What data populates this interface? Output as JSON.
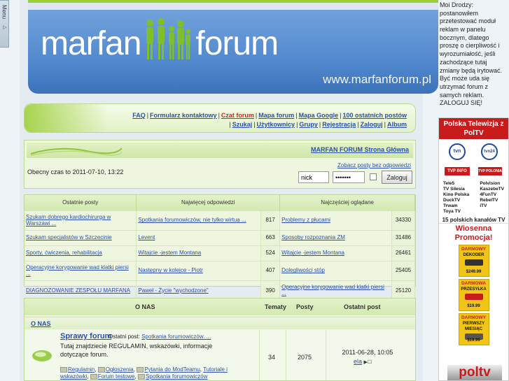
{
  "menu_tab": {
    "label": "Menu"
  },
  "header": {
    "logo_left": "marfan",
    "logo_right": "forum",
    "url": "www.marfanforum.pl"
  },
  "nav": {
    "line1": [
      "FAQ",
      "Formularz kontaktowy",
      "Czat forum",
      "Mapa forum",
      "Mapa Google",
      "100 ostatnich postów"
    ],
    "line2": [
      "Szukaj",
      "Użytkownicy",
      "Grupy",
      "Rejestracja",
      "Zaloguj",
      "Album"
    ],
    "active": "Czat forum"
  },
  "home": {
    "title": "MARFAN FORUM Strona Główna",
    "unanswered": "Zobacz posty bez odpowiedzi",
    "current_time": "Obecny czas to 2011-07-10, 13:22"
  },
  "login": {
    "username": "nick",
    "password": "•••••••",
    "button": "Zaloguj"
  },
  "stats": {
    "headers": [
      "Ostatnie posty",
      "Najwięcej odpowiedzi",
      "Najczęściej oglądane"
    ],
    "rows": [
      {
        "recent": "Szukam dobrego kardiochirurga w Warszawi ...",
        "most_replies": "Spotkania forumowiczów, nie tylko wirtua ...",
        "replies": "817",
        "most_viewed": "Problemy z płucami",
        "views": "34330"
      },
      {
        "recent": "Szukam specjalistów w Szczecinie",
        "most_replies": "Levent",
        "replies": "663",
        "most_viewed": "Sposoby rozpoznania ZM",
        "views": "31486"
      },
      {
        "recent": "Sporty, ćwiczenia, rehabilitacja",
        "most_replies": "Witajcie -jestem Montana",
        "replies": "524",
        "most_viewed": "Witajcie -jestem Montana",
        "views": "26461"
      },
      {
        "recent": "Operacyjne korygowanie wad klatki piersi ...",
        "most_replies": "Następny w kolejce - Piotr",
        "replies": "407",
        "most_viewed": "Dolegliwości stóp",
        "views": "25405"
      },
      {
        "recent": "DIAGNOZOWANIE ZESPOŁU MARFANA",
        "most_replies": "Paweł - Życie \"wychodzone\"",
        "replies": "390",
        "most_viewed": "Operacyjne korygowanie wad klatki piersi ...",
        "views": "25120"
      }
    ]
  },
  "forums": {
    "headers": {
      "name": "O NAS",
      "topics": "Tematy",
      "posts": "Posty",
      "last": "Ostatni post"
    },
    "category": "O NAS",
    "forum": {
      "name": "Sprawy forum",
      "last_post_label": "Ostatni post:",
      "last_post_link": "Spotkania forumowiczów. ...",
      "description": "Tutaj znajdziecie REGULAMIN, wskazówki, informacje dotyczące forum.",
      "subforums": [
        "Regulamin",
        "Ogłoszenia",
        "Pytania do ModTeamu",
        "Tutoriale i wskazówki",
        "Forum testowe",
        "Spotkania forumowiczów"
      ],
      "topics": "34",
      "posts": "2075",
      "last_date": "2011-06-28, 10:05",
      "last_author": "ela"
    }
  },
  "sidebar": {
    "message": "Moi Drodzy: postanowiłem przetestować moduł reklam w panelu bocznym, dlatego proszę o cierpliwość i wyrozumiałość, jeśli zachodzące tutaj zmiany będą irytować. Być może uda się utrzymać forum z samych reklam. ZALOGUJ SIĘ!",
    "ad": {
      "title": "Polska Telewizja z PolTV",
      "logo_tvn": "tvn",
      "logo_tvn24": "tvn24",
      "tvp_info": "TVP INFO",
      "tvp_polonia": "TVP POLONIA",
      "channels_left": [
        "Tele5",
        "TV Silesia",
        "Kino Polska",
        "DuckTV",
        "Trwam",
        "Toya TV"
      ],
      "channels_right": [
        "Polvision",
        "KaszebeTV",
        "4FunTV",
        "RebelTV",
        "iTV"
      ],
      "count": "15 polskich kanałów TV",
      "promo": "Wiosenna Promocja!",
      "cards": [
        {
          "top": "DARMOWY",
          "sub": "DEKODER",
          "price": "$249.99"
        },
        {
          "top": "DARMOWA",
          "sub": "PRZESYŁKA",
          "price": "$19.99"
        },
        {
          "top": "DARMOWY",
          "sub": "PIERWSZY MIESIĄC",
          "price": "$19.99"
        }
      ],
      "bottom_logo": "poltv"
    }
  }
}
